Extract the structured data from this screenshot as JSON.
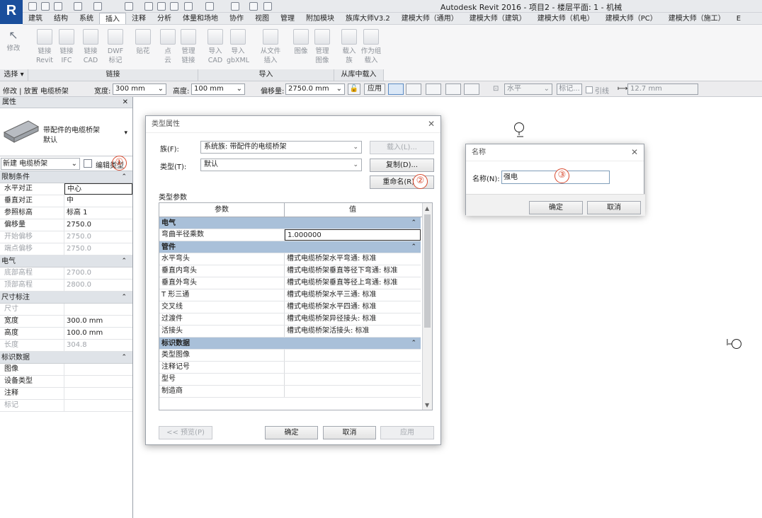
{
  "titlebar": {
    "logo": "R",
    "title": "Autodesk Revit 2016 -      项目2 - 楼层平面: 1 - 机械"
  },
  "menu": {
    "tabs": [
      "建筑",
      "结构",
      "系统",
      "插入",
      "注释",
      "分析",
      "体量和场地",
      "协作",
      "视图",
      "管理",
      "附加模块",
      "族库大师V3.2",
      "建模大师（通用）",
      "建模大师（建筑）",
      "建模大师（机电）",
      "建模大师（PC）",
      "建模大师（施工）",
      "E"
    ],
    "active": "插入"
  },
  "ribbon": {
    "modify": "修改",
    "buttons": [
      {
        "label": "链接\nRevit",
        "icon": "link-revit-icon"
      },
      {
        "label": "链接\nIFC",
        "icon": "link-ifc-icon"
      },
      {
        "label": "链接\nCAD",
        "icon": "link-cad-icon"
      },
      {
        "label": "DWF\n标记",
        "icon": "dwf-markup-icon"
      },
      {
        "label": "贴花",
        "icon": "decal-icon"
      },
      {
        "label": "点\n云",
        "icon": "point-cloud-icon"
      },
      {
        "label": "管理\n链接",
        "icon": "manage-links-icon"
      },
      {
        "label": "导入\nCAD",
        "icon": "import-cad-icon"
      },
      {
        "label": "导入\ngbXML",
        "icon": "import-gbxml-icon"
      },
      {
        "label": "从文件\n插入",
        "icon": "insert-from-file-icon"
      },
      {
        "label": "图像",
        "icon": "image-icon"
      },
      {
        "label": "管理\n图像",
        "icon": "manage-images-icon"
      },
      {
        "label": "载入\n族",
        "icon": "load-family-icon"
      },
      {
        "label": "作为组\n载入",
        "icon": "load-as-group-icon"
      }
    ],
    "panels": [
      "选择 ▾",
      "链接",
      "导入",
      "从库中载入"
    ]
  },
  "options_bar": {
    "mode": "修改 | 放置 电缆桥架",
    "width_label": "宽度:",
    "width_value": "300 mm",
    "height_label": "高度:",
    "height_value": "100 mm",
    "offset_label": "偏移量:",
    "offset_value": "2750.0 mm",
    "apply": "应用",
    "horizontal": "水平",
    "tag": "标记...",
    "leader": "引线",
    "leader_length": "12.7 mm"
  },
  "properties": {
    "title": "属性",
    "family_name": "带配件的电缆桥架",
    "family_type": "默认",
    "selector": "新建 电缆桥架",
    "edit_type": "编辑类型",
    "sections": [
      {
        "name": "限制条件",
        "rows": [
          {
            "k": "水平对正",
            "v": "中心"
          },
          {
            "k": "垂直对正",
            "v": "中"
          },
          {
            "k": "参照标高",
            "v": "标高 1"
          },
          {
            "k": "偏移量",
            "v": "2750.0"
          },
          {
            "k": "开始偏移",
            "v": "2750.0",
            "dis": true
          },
          {
            "k": "端点偏移",
            "v": "2750.0",
            "dis": true
          }
        ]
      },
      {
        "name": "电气",
        "rows": [
          {
            "k": "底部高程",
            "v": "2700.0",
            "dis": true
          },
          {
            "k": "顶部高程",
            "v": "2800.0",
            "dis": true
          }
        ]
      },
      {
        "name": "尺寸标注",
        "rows": [
          {
            "k": "尺寸",
            "v": "",
            "dis": true
          },
          {
            "k": "宽度",
            "v": "300.0 mm"
          },
          {
            "k": "高度",
            "v": "100.0 mm"
          },
          {
            "k": "长度",
            "v": "304.8",
            "dis": true
          }
        ]
      },
      {
        "name": "标识数据",
        "rows": [
          {
            "k": "图像",
            "v": ""
          },
          {
            "k": "设备类型",
            "v": ""
          },
          {
            "k": "注释",
            "v": ""
          },
          {
            "k": "标记",
            "v": "",
            "dis": true
          }
        ]
      }
    ]
  },
  "type_dialog": {
    "title": "类型属性",
    "family_label": "族(F):",
    "family_value": "系统族: 带配件的电缆桥架",
    "type_label": "类型(T):",
    "type_value": "默认",
    "load": "载入(L)...",
    "duplicate": "复制(D)...",
    "rename": "重命名(R)...",
    "params_label": "类型参数",
    "col_param": "参数",
    "col_value": "值",
    "sections": [
      {
        "name": "电气",
        "rows": [
          {
            "k": "弯曲半径乘数",
            "v": "1.000000"
          }
        ]
      },
      {
        "name": "管件",
        "rows": [
          {
            "k": "水平弯头",
            "v": "槽式电缆桥架水平弯通: 标准"
          },
          {
            "k": "垂直内弯头",
            "v": "槽式电缆桥架垂直等径下弯通: 标准"
          },
          {
            "k": "垂直外弯头",
            "v": "槽式电缆桥架垂直等径上弯通: 标准"
          },
          {
            "k": "T 形三通",
            "v": "槽式电缆桥架水平三通: 标准"
          },
          {
            "k": "交叉线",
            "v": "槽式电缆桥架水平四通: 标准"
          },
          {
            "k": "过渡件",
            "v": "槽式电缆桥架异径接头: 标准"
          },
          {
            "k": "活接头",
            "v": "槽式电缆桥架活接头: 标准"
          }
        ]
      },
      {
        "name": "标识数据",
        "rows": [
          {
            "k": "类型图像",
            "v": ""
          },
          {
            "k": "注释记号",
            "v": ""
          },
          {
            "k": "型号",
            "v": ""
          },
          {
            "k": "制造商",
            "v": ""
          }
        ]
      }
    ],
    "preview": "<< 预览(P)",
    "ok": "确定",
    "cancel": "取消",
    "apply": "应用"
  },
  "name_dialog": {
    "title": "名称",
    "label": "名称(N):",
    "value": "强电",
    "ok": "确定",
    "cancel": "取消"
  },
  "annotations": [
    "①",
    "②",
    "③"
  ],
  "colors": {
    "logo": "#1b4f9c",
    "section_header": "#a9c0d9",
    "marker": "#d94a2f"
  }
}
